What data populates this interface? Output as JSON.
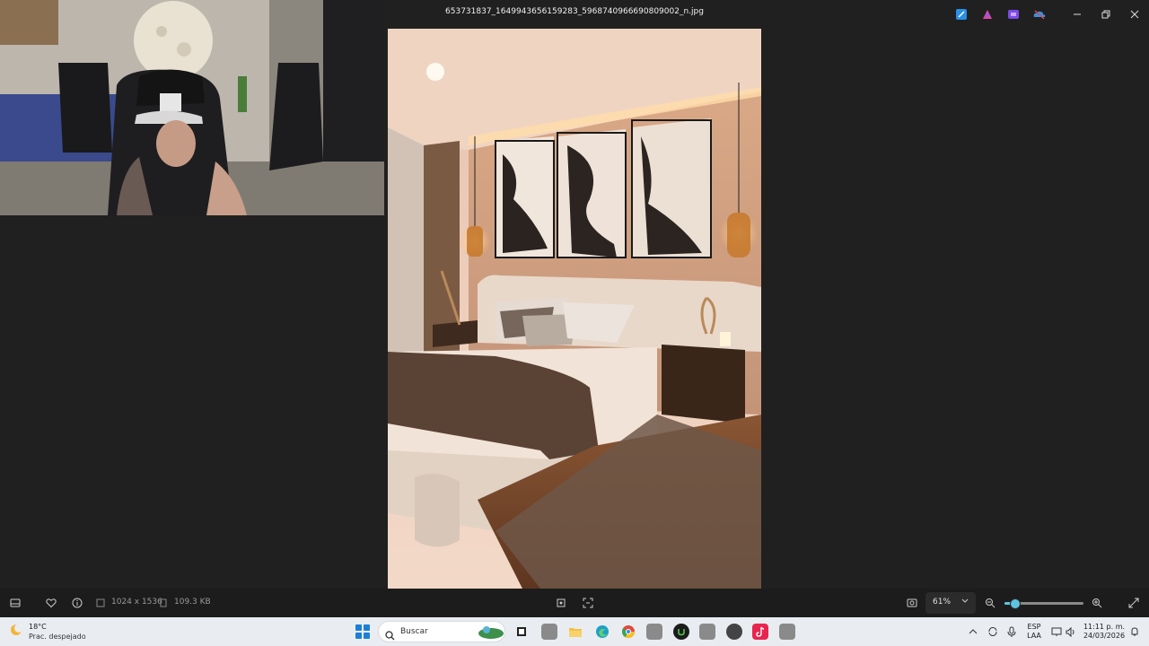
{
  "window": {
    "title": "653731837_1649943656159283_5968740966690809002_n.jpg",
    "extensions": [
      "edit-icon",
      "designer-icon",
      "clipchamp-icon",
      "onedrive-icon"
    ],
    "controls": [
      "minimize-icon",
      "restore-icon",
      "close-icon"
    ]
  },
  "toolbar": {
    "dimensions": "1024 x 1536",
    "file_size": "109.3 KB",
    "zoom_label": "61%",
    "zoom_level": 0.13
  },
  "taskbar": {
    "weather_temp": "18°C",
    "weather_desc": "Prac. despejado",
    "search_placeholder": "Buscar",
    "apps": [
      "widgets-icon",
      "task-view-icon",
      "app-icon",
      "file-explorer-icon",
      "edge-icon",
      "chrome-icon",
      "app-icon",
      "upwork-icon",
      "app-icon",
      "app-icon",
      "tiktok-icon",
      "app-icon"
    ],
    "lang_top": "ESP",
    "lang_bottom": "LAA",
    "time": "11:11 p. m.",
    "date": "24/03/2026"
  },
  "colors": {
    "viewer_bg": "#202020",
    "taskbar_bg": "#e9edf1",
    "accent": "#5ec4e0"
  }
}
